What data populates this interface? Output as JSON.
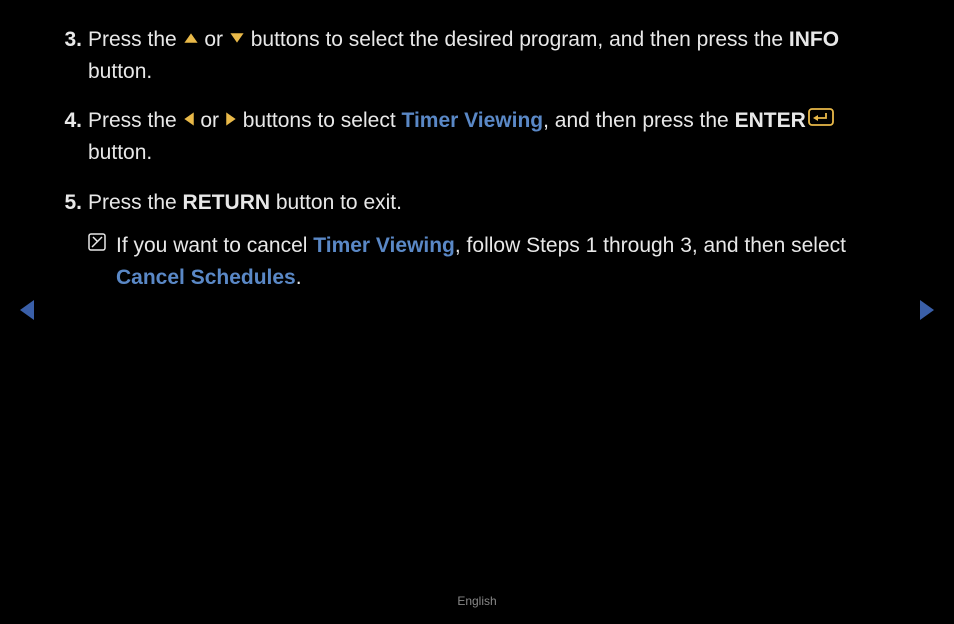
{
  "steps": {
    "s3": {
      "num": "3.",
      "t1": "Press the ",
      "t2": " or ",
      "t3": " buttons to select the desired program, and then press the ",
      "bold1": "INFO",
      "t4": " button."
    },
    "s4": {
      "num": "4.",
      "t1": "Press the ",
      "t2": " or ",
      "t3": " buttons to select ",
      "link1": "Timer Viewing",
      "t4": ", and then press the ",
      "bold1": "ENTER",
      "t5": " button."
    },
    "s5": {
      "num": "5.",
      "t1": "Press the ",
      "bold1": "RETURN",
      "t2": " button to exit."
    },
    "note": {
      "t1": "If you want to cancel ",
      "link1": "Timer Viewing",
      "t2": ", follow Steps 1 through 3, and then select ",
      "link2": "Cancel Schedules",
      "t3": "."
    }
  },
  "footer": {
    "lang": "English"
  }
}
